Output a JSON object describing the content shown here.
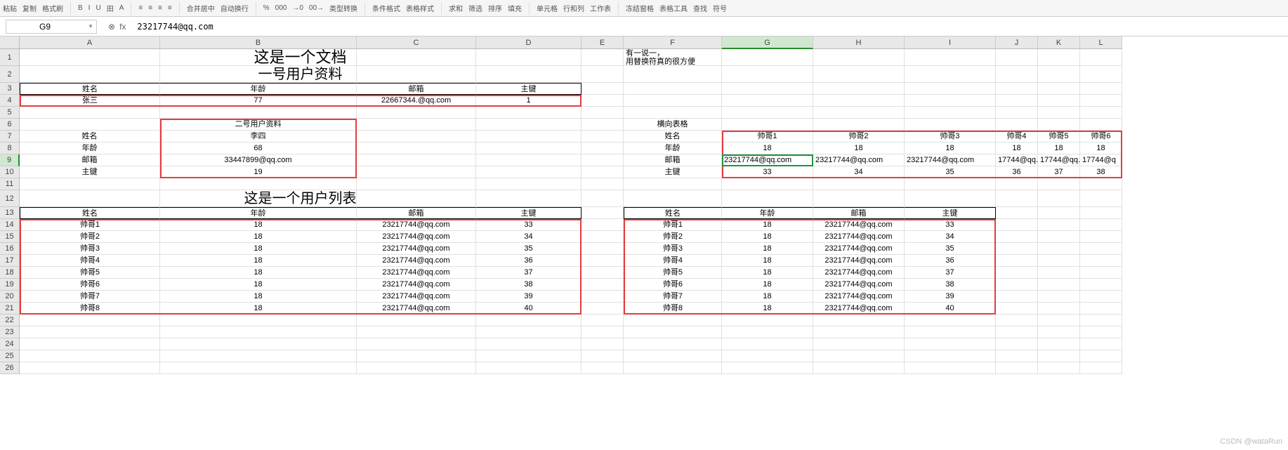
{
  "toolbar": [
    "粘贴",
    "复制",
    "格式刷",
    "|",
    "B",
    "I",
    "U",
    "田",
    "A",
    "|",
    "≡",
    "≡",
    "≡",
    "≡",
    "|",
    "合并居中",
    "自动换行",
    "|",
    "%",
    "000",
    "→0",
    "00→",
    "类型转换",
    "|",
    "条件格式",
    "表格样式",
    "|",
    "求和",
    "筛选",
    "排序",
    "填充",
    "|",
    "单元格",
    "行和列",
    "工作表",
    "|",
    "冻结窗格",
    "表格工具",
    "查找",
    "符号"
  ],
  "formulaBar": {
    "cellRef": "G9",
    "formula": "23217744@qq.com",
    "fx": "fx"
  },
  "cols": {
    "labels": [
      "A",
      "B",
      "C",
      "D",
      "E",
      "F",
      "G",
      "H",
      "I",
      "J",
      "K",
      "L"
    ],
    "widths": [
      200,
      280,
      170,
      150,
      60,
      140,
      130,
      130,
      130,
      60,
      60,
      60
    ]
  },
  "rows": {
    "count": 26,
    "heights": {
      "1": 24,
      "2": 24,
      "12": 24
    }
  },
  "activeCell": "G9",
  "watermark": "CSDN @wataRun",
  "content": {
    "A1_merge": "这是一个文档",
    "A2_merge": "一号用户资料",
    "F1_a": "有一说一，",
    "F1_b": "用替换符真的很方便",
    "hdr1": [
      "姓名",
      "年龄",
      "邮箱",
      "主键"
    ],
    "row4": [
      "张三",
      "77",
      "22667344.@qq.com",
      "1"
    ],
    "B6": "二号用户资料",
    "v2_labels": [
      "姓名",
      "年龄",
      "邮箱",
      "主键"
    ],
    "v2_vals": [
      "李四",
      "68",
      "33447899@qq.com",
      "19"
    ],
    "F6": "横向表格",
    "h_labels": [
      "姓名",
      "年龄",
      "邮箱",
      "主键"
    ],
    "h_row7": [
      "帅哥1",
      "帅哥2",
      "帅哥3",
      "帅哥4",
      "帅哥5",
      "帅哥6"
    ],
    "h_row8": [
      "18",
      "18",
      "18",
      "18",
      "18",
      "18"
    ],
    "h_row9": [
      "23217744@qq.com",
      "23217744@qq.com",
      "23217744@qq.com",
      "17744@qq.",
      "17744@qq.",
      "17744@q"
    ],
    "h_row10": [
      "33",
      "34",
      "35",
      "36",
      "37",
      "38"
    ],
    "A12_merge": "这是一个用户列表",
    "hdr13": [
      "姓名",
      "年龄",
      "邮箱",
      "主键"
    ],
    "list1": [
      [
        "帅哥1",
        "18",
        "23217744@qq.com",
        "33"
      ],
      [
        "帅哥2",
        "18",
        "23217744@qq.com",
        "34"
      ],
      [
        "帅哥3",
        "18",
        "23217744@qq.com",
        "35"
      ],
      [
        "帅哥4",
        "18",
        "23217744@qq.com",
        "36"
      ],
      [
        "帅哥5",
        "18",
        "23217744@qq.com",
        "37"
      ],
      [
        "帅哥6",
        "18",
        "23217744@qq.com",
        "38"
      ],
      [
        "帅哥7",
        "18",
        "23217744@qq.com",
        "39"
      ],
      [
        "帅哥8",
        "18",
        "23217744@qq.com",
        "40"
      ]
    ],
    "hdr13b": [
      "姓名",
      "年龄",
      "邮箱",
      "主键"
    ],
    "list2": [
      [
        "帅哥1",
        "18",
        "23217744@qq.com",
        "33"
      ],
      [
        "帅哥2",
        "18",
        "23217744@qq.com",
        "34"
      ],
      [
        "帅哥3",
        "18",
        "23217744@qq.com",
        "35"
      ],
      [
        "帅哥4",
        "18",
        "23217744@qq.com",
        "36"
      ],
      [
        "帅哥5",
        "18",
        "23217744@qq.com",
        "37"
      ],
      [
        "帅哥6",
        "18",
        "23217744@qq.com",
        "38"
      ],
      [
        "帅哥7",
        "18",
        "23217744@qq.com",
        "39"
      ],
      [
        "帅哥8",
        "18",
        "23217744@qq.com",
        "40"
      ]
    ]
  }
}
